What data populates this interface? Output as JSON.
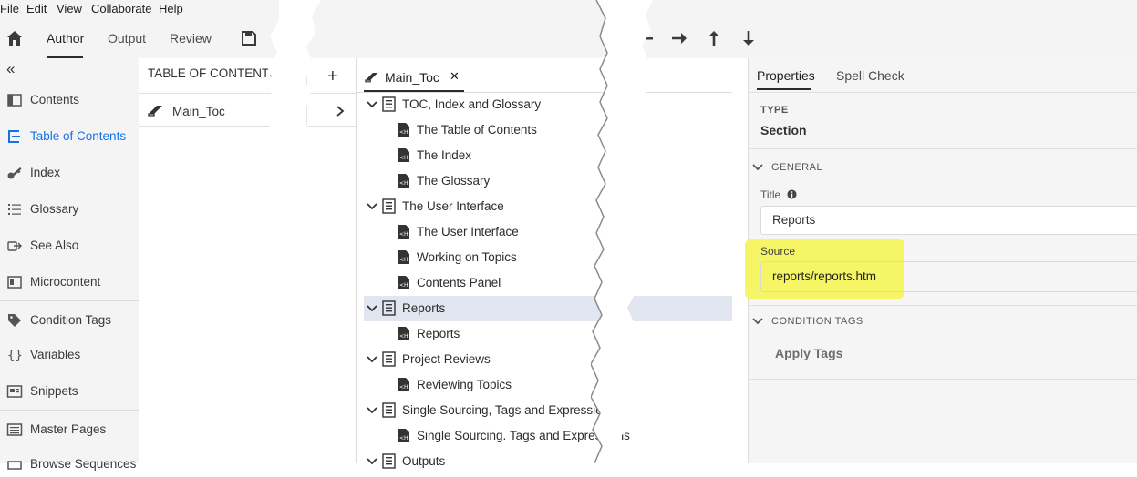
{
  "menu": [
    "File",
    "Edit",
    "View",
    "Collaborate",
    "Help"
  ],
  "toolbar": {
    "tabs": [
      "Author",
      "Output",
      "Review"
    ],
    "active_tab": "Author"
  },
  "leftnav": {
    "collapse_glyph": "«",
    "items": [
      "Contents",
      "Table of Contents",
      "Index",
      "Glossary",
      "See Also",
      "Microcontent",
      "Condition Tags",
      "Variables",
      "Snippets",
      "Master Pages",
      "Browse Sequences"
    ],
    "active": "Table of Contents"
  },
  "toc_panel": {
    "heading": "TABLE OF CONTENTS",
    "add_glyph": "+",
    "items": [
      "Main_Toc"
    ]
  },
  "editor": {
    "tab_label": "Main_Toc",
    "close_glyph": "✕"
  },
  "tree": [
    {
      "label": "TOC, Index and Glossary",
      "level": 0
    },
    {
      "label": "The Table of Contents",
      "level": 1
    },
    {
      "label": "The Index",
      "level": 1
    },
    {
      "label": "The Glossary",
      "level": 1
    },
    {
      "label": "The User Interface",
      "level": 0
    },
    {
      "label": "The User Interface",
      "level": 1
    },
    {
      "label": "Working on Topics",
      "level": 1
    },
    {
      "label": "Contents Panel",
      "level": 1
    },
    {
      "label": "Reports",
      "level": 0,
      "selected": true
    },
    {
      "label": "Reports",
      "level": 1
    },
    {
      "label": "Project Reviews",
      "level": 0
    },
    {
      "label": "Reviewing Topics",
      "level": 1
    },
    {
      "label": "Single Sourcing, Tags and Expressions",
      "level": 0
    },
    {
      "label": "Single Sourcing. Tags and Expressions",
      "level": 1
    },
    {
      "label": "Outputs",
      "level": 0
    }
  ],
  "properties": {
    "tabs": [
      "Properties",
      "Spell Check"
    ],
    "active_tab": "Properties",
    "type_label": "TYPE",
    "type_value": "Section",
    "general_label": "GENERAL",
    "title_label": "Title",
    "title_value": "Reports",
    "source_label": "Source",
    "source_value": "reports/reports.htm",
    "condition_tags_label": "CONDITION TAGS",
    "apply_tags_label": "Apply Tags"
  },
  "colors": {
    "accent": "#1473e6",
    "highlight": "#f5f566",
    "selected_row": "#e1e6f0"
  }
}
